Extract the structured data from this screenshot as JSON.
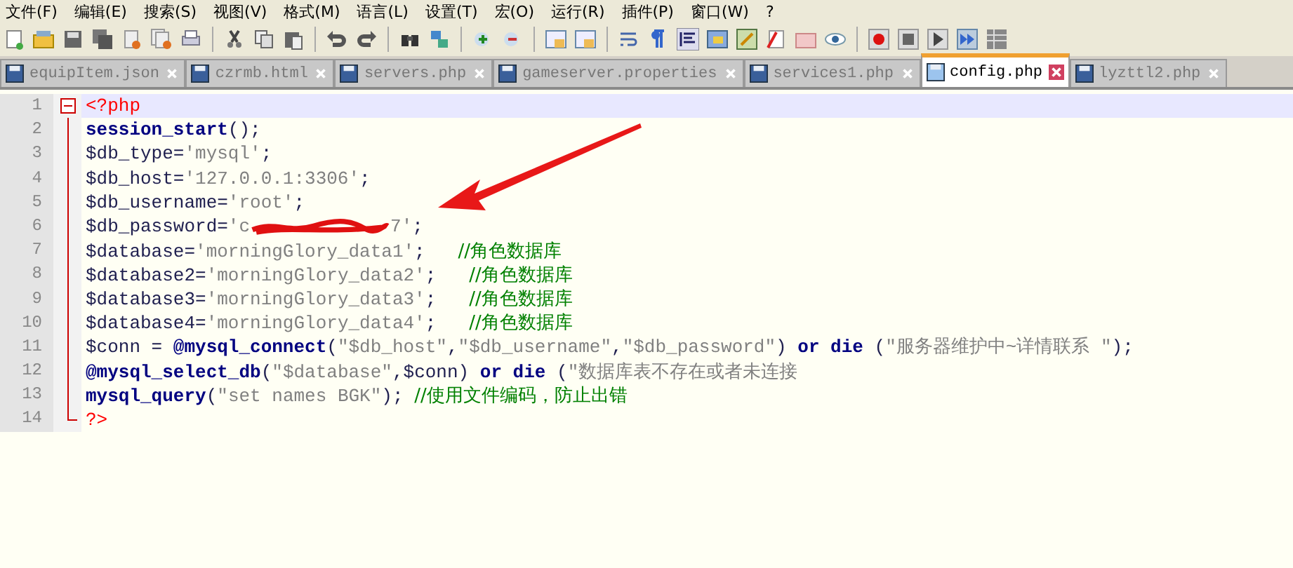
{
  "menu": [
    "文件(F)",
    "编辑(E)",
    "搜索(S)",
    "视图(V)",
    "格式(M)",
    "语言(L)",
    "设置(T)",
    "宏(O)",
    "运行(R)",
    "插件(P)",
    "窗口(W)",
    "?"
  ],
  "tabs": [
    {
      "label": "equipItem.json",
      "selected": false
    },
    {
      "label": "czrmb.html",
      "selected": false
    },
    {
      "label": "servers.php",
      "selected": false
    },
    {
      "label": "gameserver.properties",
      "selected": false
    },
    {
      "label": "services1.php",
      "selected": false
    },
    {
      "label": "config.php",
      "selected": true
    },
    {
      "label": "lyzttl2.php",
      "selected": false
    }
  ],
  "editor": {
    "lines": [
      {
        "number": "1",
        "current": true,
        "tokens": [
          {
            "kind": "tag",
            "text": "<?php"
          }
        ]
      },
      {
        "number": "2",
        "current": false,
        "tokens": [
          {
            "kind": "keyword",
            "text": "session_start"
          },
          {
            "kind": "plain",
            "text": "();"
          }
        ]
      },
      {
        "number": "3",
        "current": false,
        "tokens": [
          {
            "kind": "plain",
            "text": "$db_type="
          },
          {
            "kind": "string",
            "text": "'mysql'"
          },
          {
            "kind": "plain",
            "text": ";"
          }
        ]
      },
      {
        "number": "4",
        "current": false,
        "tokens": [
          {
            "kind": "plain",
            "text": "$db_host="
          },
          {
            "kind": "string",
            "text": "'127.0.0.1:3306'"
          },
          {
            "kind": "plain",
            "text": ";"
          }
        ]
      },
      {
        "number": "5",
        "current": false,
        "tokens": [
          {
            "kind": "plain",
            "text": "$db_username="
          },
          {
            "kind": "string",
            "text": "'root'"
          },
          {
            "kind": "plain",
            "text": ";"
          }
        ]
      },
      {
        "number": "6",
        "current": false,
        "tokens": [
          {
            "kind": "plain",
            "text": "$db_password="
          },
          {
            "kind": "string",
            "text": "'c"
          },
          {
            "kind": "redacted"
          },
          {
            "kind": "string",
            "text": "7'"
          },
          {
            "kind": "plain",
            "text": ";"
          }
        ]
      },
      {
        "number": "7",
        "current": false,
        "tokens": [
          {
            "kind": "plain",
            "text": "$database="
          },
          {
            "kind": "string",
            "text": "'morningGlory_data1'"
          },
          {
            "kind": "plain",
            "text": ";   "
          },
          {
            "kind": "comment",
            "text": "//角色数据库"
          }
        ]
      },
      {
        "number": "8",
        "current": false,
        "tokens": [
          {
            "kind": "plain",
            "text": "$database2="
          },
          {
            "kind": "string",
            "text": "'morningGlory_data2'"
          },
          {
            "kind": "plain",
            "text": ";   "
          },
          {
            "kind": "comment",
            "text": "//角色数据库"
          }
        ]
      },
      {
        "number": "9",
        "current": false,
        "tokens": [
          {
            "kind": "plain",
            "text": "$database3="
          },
          {
            "kind": "string",
            "text": "'morningGlory_data3'"
          },
          {
            "kind": "plain",
            "text": ";   "
          },
          {
            "kind": "comment",
            "text": "//角色数据库"
          }
        ]
      },
      {
        "number": "10",
        "current": false,
        "tokens": [
          {
            "kind": "plain",
            "text": "$database4="
          },
          {
            "kind": "string",
            "text": "'morningGlory_data4'"
          },
          {
            "kind": "plain",
            "text": ";   "
          },
          {
            "kind": "comment",
            "text": "//角色数据库"
          }
        ]
      },
      {
        "number": "11",
        "current": false,
        "tokens": [
          {
            "kind": "plain",
            "text": "$conn = "
          },
          {
            "kind": "keyword",
            "text": "@mysql_connect"
          },
          {
            "kind": "plain",
            "text": "("
          },
          {
            "kind": "string",
            "text": "\"$db_host\""
          },
          {
            "kind": "plain",
            "text": ","
          },
          {
            "kind": "string",
            "text": "\"$db_username\""
          },
          {
            "kind": "plain",
            "text": ","
          },
          {
            "kind": "string",
            "text": "\"$db_password\""
          },
          {
            "kind": "plain",
            "text": ") "
          },
          {
            "kind": "keyword",
            "text": "or die"
          },
          {
            "kind": "plain",
            "text": " ("
          },
          {
            "kind": "string",
            "text": "\"服务器维护中~详情联系 \""
          },
          {
            "kind": "plain",
            "text": ");"
          }
        ]
      },
      {
        "number": "12",
        "current": false,
        "tokens": [
          {
            "kind": "keyword",
            "text": "@mysql_select_db"
          },
          {
            "kind": "plain",
            "text": "("
          },
          {
            "kind": "string",
            "text": "\"$database\""
          },
          {
            "kind": "plain",
            "text": ",$conn) "
          },
          {
            "kind": "keyword",
            "text": "or die"
          },
          {
            "kind": "plain",
            "text": " ("
          },
          {
            "kind": "string",
            "text": "\"数据库表不存在或者未连接"
          }
        ]
      },
      {
        "number": "13",
        "current": false,
        "tokens": [
          {
            "kind": "keyword",
            "text": "mysql_query"
          },
          {
            "kind": "plain",
            "text": "("
          },
          {
            "kind": "string",
            "text": "\"set names BGK\""
          },
          {
            "kind": "plain",
            "text": "); "
          },
          {
            "kind": "comment",
            "text": "//使用文件编码，防止出错"
          }
        ]
      },
      {
        "number": "14",
        "current": false,
        "tokens": [
          {
            "kind": "tag",
            "text": "?>"
          }
        ]
      }
    ]
  }
}
